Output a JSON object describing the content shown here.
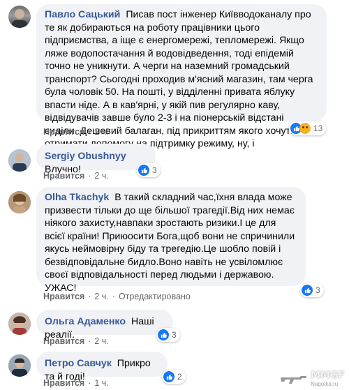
{
  "comments": [
    {
      "author": "Павло Сацький",
      "text": "Писав пост інженер Київводоканалу про те як добираються на роботу працівники цього підприємства, а іще є енергомережі, тепломережі. Якщо ляже водопостачання й водовідведення, тоді епідемій точно не уникнути. А черги на наземний громадський транспорт? Сьогодні проходив м'ясний магазин, там черга була чоловік 50. На пошті, у відділенні привата яблуку впасти ніде. А в кав'ярні, у якій пив регулярно каву, відвідувачів завше було 2-3 і на піонерській відстані сиділи. Дешевий балаган, під прикриттям якого хочуть отримати допомогу на підтримку режиму, ну, і повноваження",
      "like_label": "Нравится",
      "time": "2 ч.",
      "reaction_count": "13",
      "reactions": [
        "like-icon",
        "sad-icon"
      ]
    },
    {
      "author": "Sergiy Obushnyy",
      "text": "Влучно!",
      "like_label": "Нравится",
      "time": "2 ч.",
      "reaction_count": "3",
      "reactions": [
        "like-icon"
      ]
    },
    {
      "author": "Olha Tkachyk",
      "text": "В такий складний час,їхня влада може призвести тільки до ще більшої трагедії.Від них немає ніякого захисту,навпаки зростають ризики.І це для всієї країни! Приюосити Бога,щоб вони не спричинили якусь неймовірну біду та трегедію.Це шобло повій і безвідповідальне бидло.Воно навіть не усвіломлює своєї відповідальності перед людьми і державою.\nУЖАС!",
      "like_label": "Нравится",
      "time": "2 ч.",
      "edited": "Отредактировано",
      "reaction_count": "3",
      "reactions": [
        "like-icon"
      ]
    },
    {
      "author": "Ольга Адаменко",
      "text": "Наші реалії.",
      "like_label": "Нравится",
      "time": "2 ч.",
      "reaction_count": "3",
      "reactions": [
        "like-icon"
      ]
    },
    {
      "author": "Петро Савчук",
      "text": "Прикро та й годі!",
      "like_label": "Нравится",
      "time": "1 ч.",
      "reaction_count": "2",
      "reactions": [
        "like-icon"
      ]
    }
  ],
  "watermark": {
    "text": "MMGF",
    "subtext": "Nagotka.ru"
  },
  "colors": {
    "author": "#385898",
    "bubble": "#f0f2f5",
    "like": "#1877f2",
    "meta": "#65676b"
  }
}
